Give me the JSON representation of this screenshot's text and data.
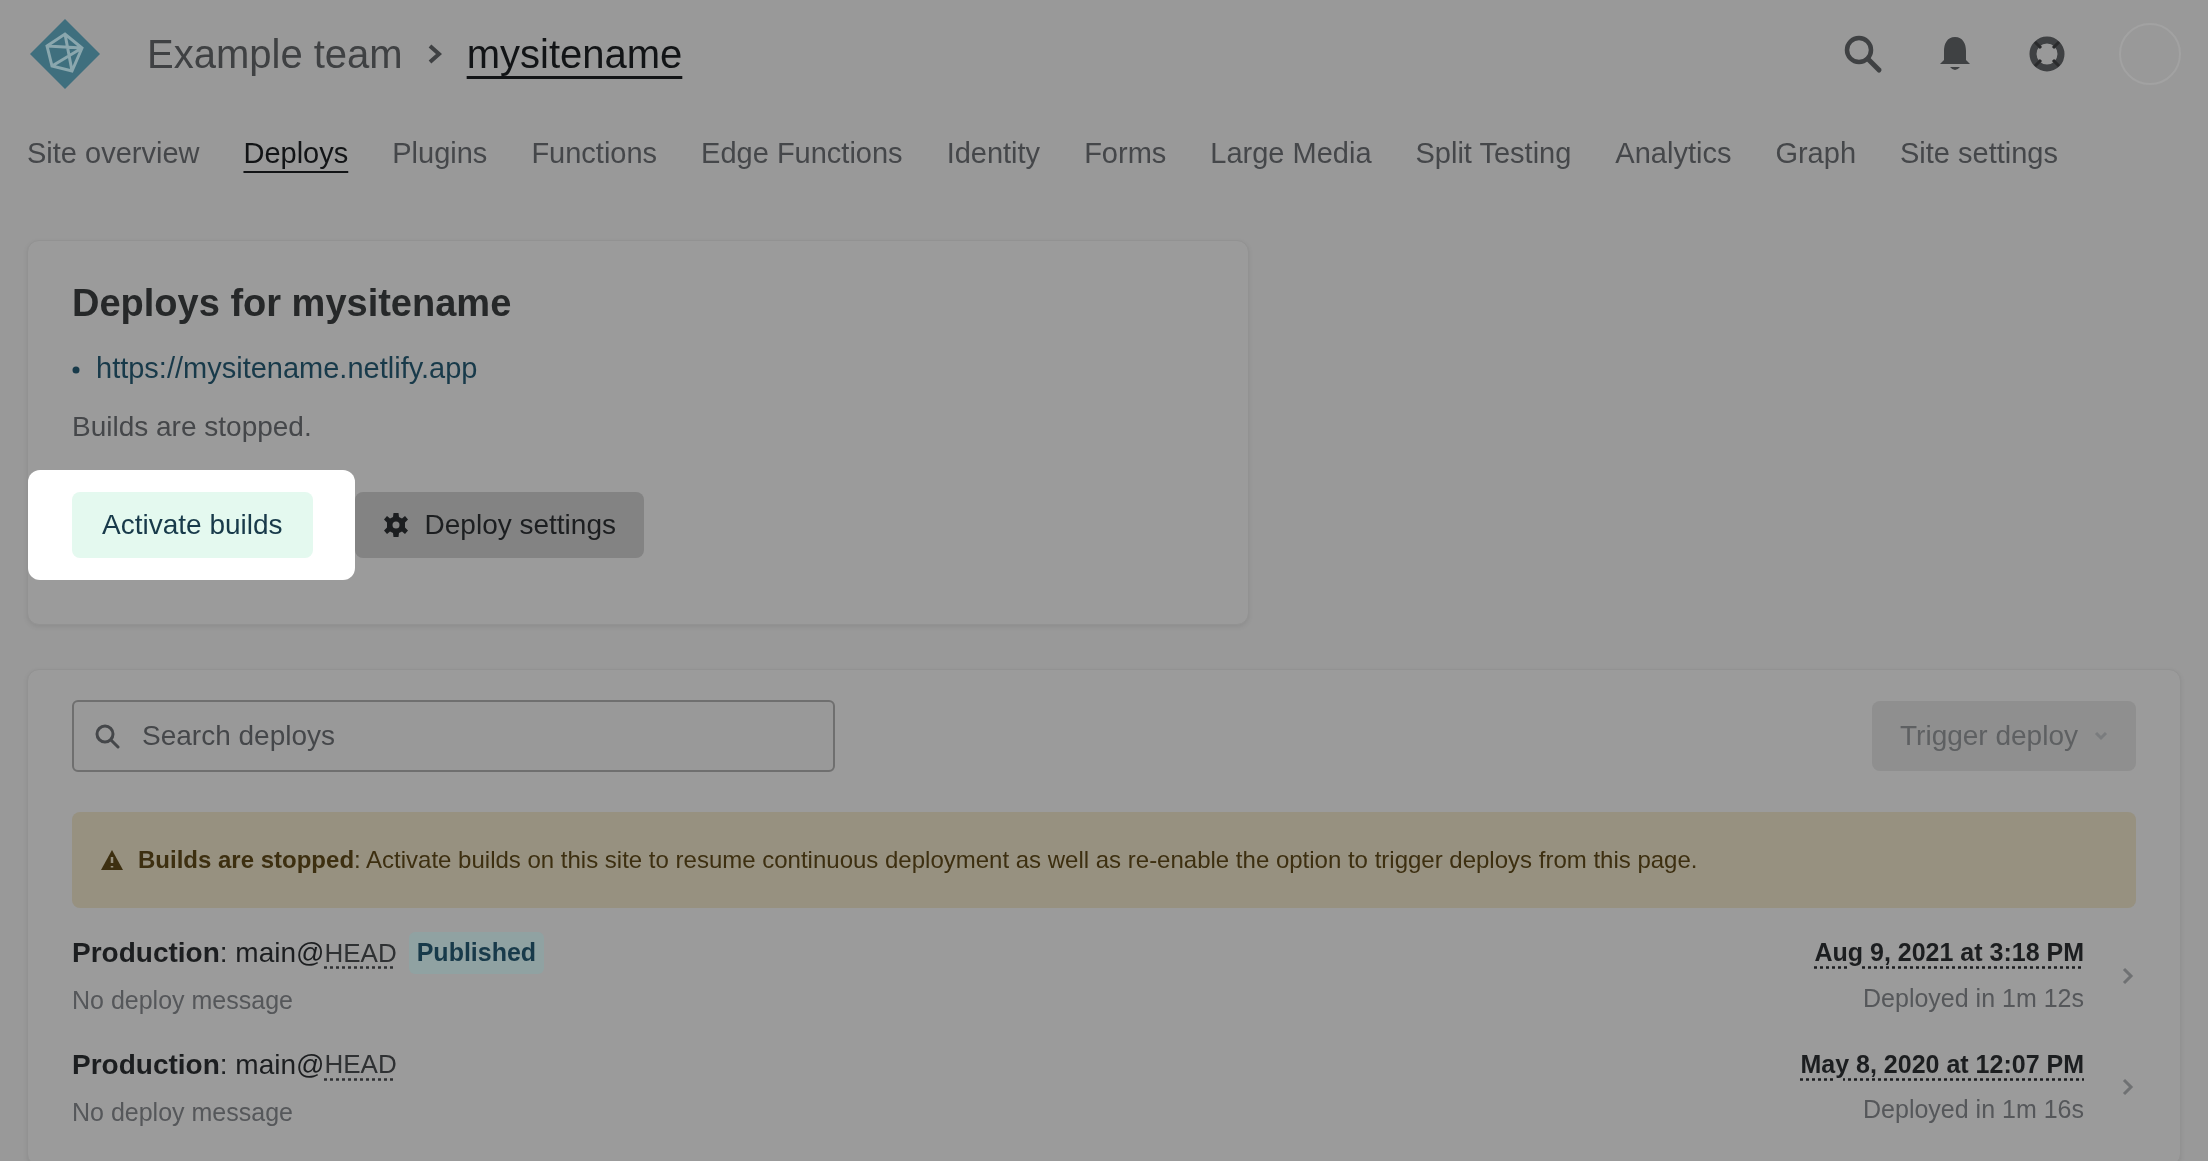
{
  "header": {
    "breadcrumb": [
      {
        "label": "Example team",
        "current": false
      },
      {
        "label": "mysitename",
        "current": true
      }
    ]
  },
  "nav": [
    {
      "label": "Site overview",
      "selected": false
    },
    {
      "label": "Deploys",
      "selected": true
    },
    {
      "label": "Plugins",
      "selected": false
    },
    {
      "label": "Functions",
      "selected": false
    },
    {
      "label": "Edge Functions",
      "selected": false
    },
    {
      "label": "Identity",
      "selected": false
    },
    {
      "label": "Forms",
      "selected": false
    },
    {
      "label": "Large Media",
      "selected": false
    },
    {
      "label": "Split Testing",
      "selected": false
    },
    {
      "label": "Analytics",
      "selected": false
    },
    {
      "label": "Graph",
      "selected": false
    },
    {
      "label": "Site settings",
      "selected": false
    }
  ],
  "deploys_card": {
    "title": "Deploys for mysitename",
    "links": [
      "https://mysitename.netlify.app"
    ],
    "status": "Builds are stopped.",
    "buttons": [
      {
        "label": "Activate builds",
        "kind": "primary",
        "highlighted": true
      },
      {
        "label": "Deploy settings",
        "kind": "settings",
        "highlighted": false
      }
    ]
  },
  "deploy_list": {
    "search": {
      "placeholder": "Search deploys"
    },
    "trigger_button": {
      "label": "Trigger deploy",
      "disabled": true
    },
    "alert": {
      "text": "**Builds are stopped**: Activate builds on this site to resume continuous deployment as well as re-enable the option to trigger deploys from this page."
    },
    "deploys": [
      {
        "title": "**Production**: main@",
        "ref": "HEAD",
        "badge": "Published",
        "message": "No deploy message",
        "date": "Aug 9, 2021 at 3:18 PM",
        "duration": "Deployed in 1m 12s"
      },
      {
        "title": "**Production**: main@",
        "ref": "HEAD",
        "message": "No deploy message",
        "date": "May 8, 2020 at 12:07 PM",
        "duration": "Deployed in 1m 16s"
      }
    ]
  }
}
